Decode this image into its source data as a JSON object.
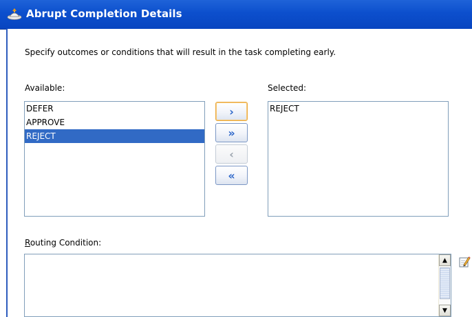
{
  "dialog": {
    "title": "Abrupt Completion Details",
    "description": "Specify outcomes or conditions that will result in the task completing early."
  },
  "available": {
    "label": "Available:",
    "items": [
      "DEFER",
      "APPROVE",
      "REJECT"
    ],
    "selected_item": "REJECT"
  },
  "selected": {
    "label": "Selected:",
    "items": [
      "REJECT"
    ]
  },
  "shuttle": {
    "move": "›",
    "move_all": "»",
    "remove": "‹",
    "remove_all": "«"
  },
  "routing": {
    "label_mnemonic": "R",
    "label_rest": "outing Condition:",
    "value": ""
  },
  "icons": {
    "title": "task-icon",
    "edit": "edit-pencil-icon",
    "scroll_up": "scroll-up-arrow-icon",
    "scroll_down": "scroll-down-arrow-icon"
  },
  "colors": {
    "title_bar": "#0c4fcd",
    "selection": "#316ac5",
    "shuttle_arrow": "#2c66c9"
  }
}
